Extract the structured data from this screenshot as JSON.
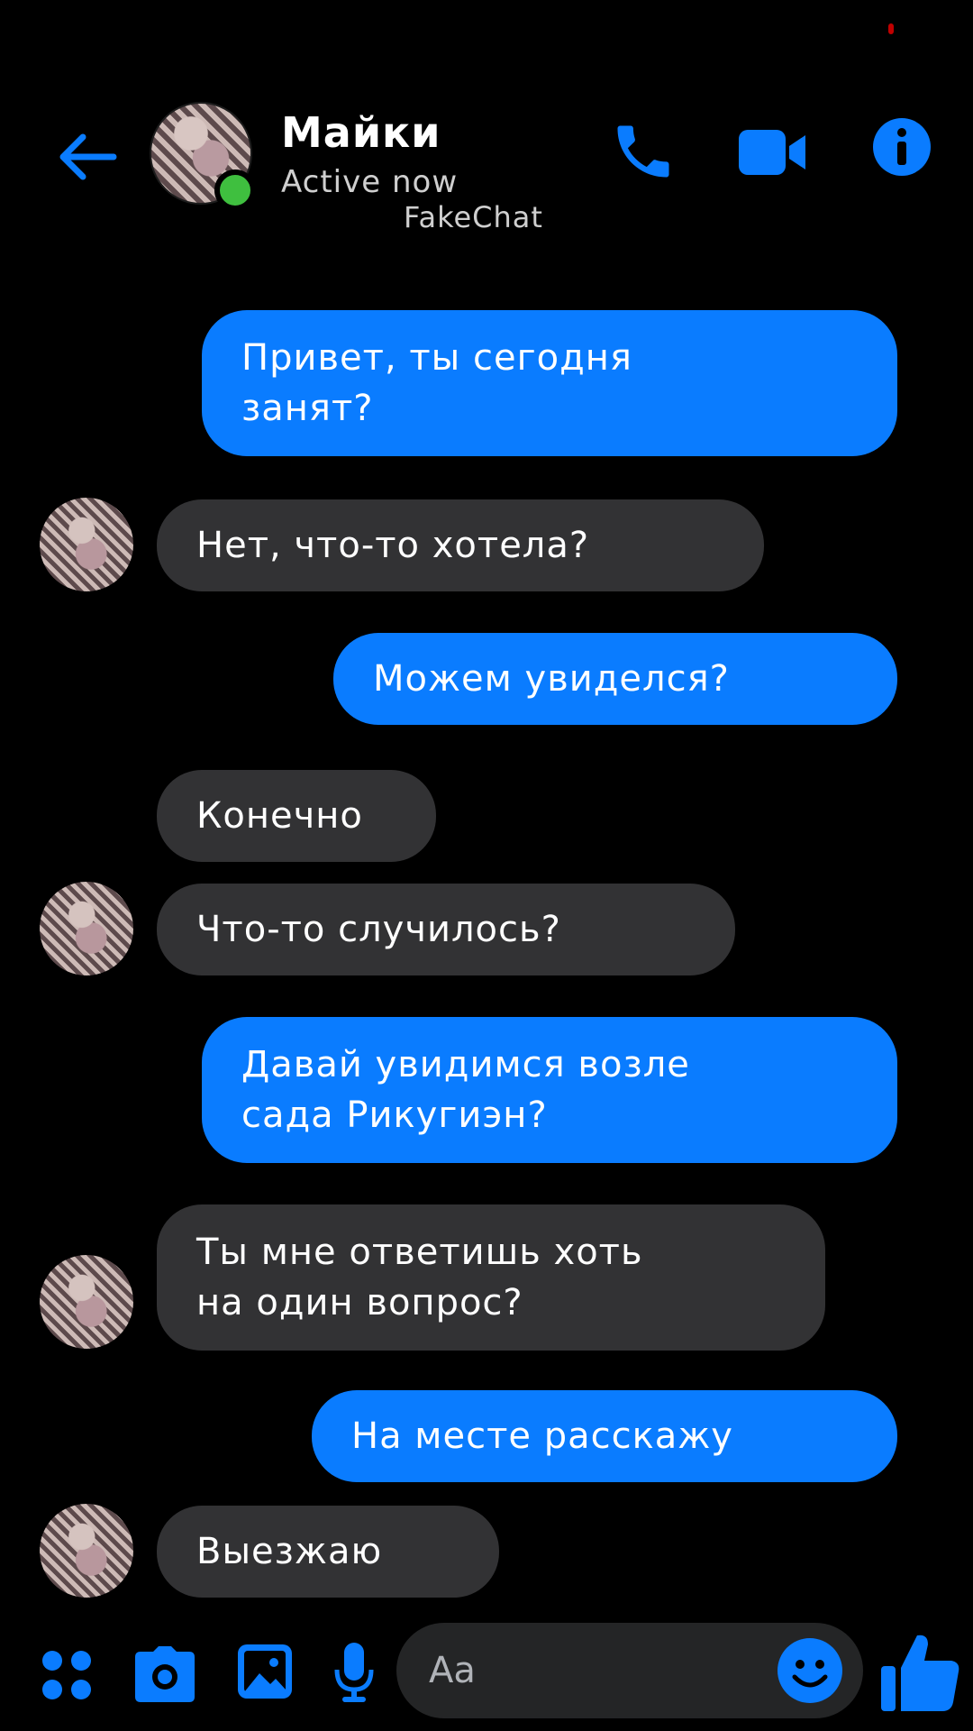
{
  "header": {
    "contact_name": "Майки",
    "status": "Active now",
    "watermark": "FakeChat"
  },
  "icons": {
    "back": "back-arrow-icon",
    "call": "phone-icon",
    "video": "video-camera-icon",
    "info": "info-icon",
    "apps": "apps-icon",
    "camera": "camera-icon",
    "gallery": "image-icon",
    "mic": "microphone-icon",
    "emoji": "smiley-icon",
    "like": "thumbs-up-icon"
  },
  "colors": {
    "accent": "#0a7cff",
    "incoming_bubble": "#323234",
    "background": "#000000",
    "online": "#3fbf3f"
  },
  "messages": [
    {
      "from": "me",
      "text": "Привет, ты сегодня\nзанят?"
    },
    {
      "from": "them",
      "text": "Нет, что-то хотела?"
    },
    {
      "from": "me",
      "text": "Можем увиделся?"
    },
    {
      "from": "them",
      "text": "Конечно"
    },
    {
      "from": "them",
      "text": "Что-то случилось?"
    },
    {
      "from": "me",
      "text": "Давай увидимся возле\nсада Рикугиэн?"
    },
    {
      "from": "them",
      "text": "Ты мне ответишь хоть\nна один вопрос?"
    },
    {
      "from": "me",
      "text": "На месте расскажу"
    },
    {
      "from": "them",
      "text": "Выезжаю"
    }
  ],
  "composer": {
    "placeholder": "Aa"
  }
}
